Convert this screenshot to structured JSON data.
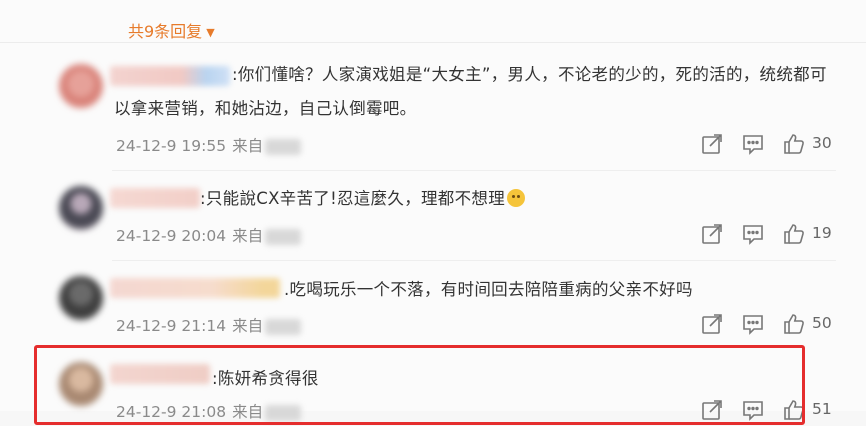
{
  "header": {
    "reply_count_label": "共9条回复"
  },
  "comments": [
    {
      "text": ":你们懂啥？人家演戏姐是“大女主”，男人，不论老的少的，死的活的，统统都可以拿来营销，和她沾边，自己认倒霉吧。",
      "line1": ":你们懂啥？人家演戏姐是“大女主”，男人，不论老的少的，死的活的，统统都可",
      "line2": "以拿来营销，和她沾边，自己认倒霉吧。",
      "time": "24-12-9 19:55",
      "source_prefix": "来自",
      "likes": "30"
    },
    {
      "text": ":只能說CX辛苦了!忍這麼久，理都不想理",
      "time": "24-12-9 20:04",
      "source_prefix": "来自",
      "likes": "19"
    },
    {
      "text": ".吃喝玩乐一个不落，有时间回去陪陪重病的父亲不好吗",
      "time": "24-12-9 21:14",
      "source_prefix": "来自",
      "likes": "50"
    },
    {
      "text": ":陈妍希贪得很",
      "time": "24-12-9 21:08",
      "source_prefix": "来自",
      "likes": "51"
    }
  ],
  "icons": {
    "share": "share-icon",
    "comment": "comment-icon",
    "like": "thumbs-up-icon",
    "caret": "caret-down-icon"
  },
  "colors": {
    "accent_orange": "#e77b2b",
    "highlight_red": "#e52d2d",
    "meta_gray": "#8a8a8a"
  }
}
